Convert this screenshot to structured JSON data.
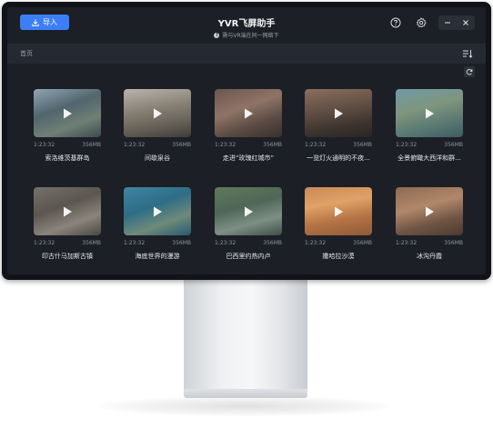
{
  "app": {
    "title": "YVR飞屏助手",
    "subtitle": "需与VR端在同一网络下",
    "import_label": "导入"
  },
  "nav": {
    "breadcrumb": "首页"
  },
  "icons": {
    "import": "download-icon",
    "help": "question-icon",
    "settings": "gear-icon",
    "minimize": "minimize-icon",
    "close": "close-icon",
    "sort": "sort-icon",
    "refresh": "refresh-icon",
    "play": "play-icon"
  },
  "colors": {
    "accent": "#3c7ef5",
    "background": "#1c1f26",
    "navbar": "#252932"
  },
  "videos": [
    {
      "title": "索洛维茨基群岛",
      "duration": "1:23:32",
      "size": "356MB"
    },
    {
      "title": "间歇泉谷",
      "duration": "1:23:32",
      "size": "356MB"
    },
    {
      "title": "走进“玫瑰红城市”",
      "duration": "1:23:32",
      "size": "356MB"
    },
    {
      "title": "一览灯火通明的不夜...",
      "duration": "1:23:32",
      "size": "356MB"
    },
    {
      "title": "全景俯瞰大西洋和群...",
      "duration": "1:23:32",
      "size": "356MB"
    },
    {
      "title": "印古什马加斯古镇",
      "duration": "1:23:32",
      "size": "356MB"
    },
    {
      "title": "海底世界的漫游",
      "duration": "1:23:32",
      "size": "356MB"
    },
    {
      "title": "巴西里约热内卢",
      "duration": "1:23:32",
      "size": "356MB"
    },
    {
      "title": "撒哈拉沙漠",
      "duration": "1:23:32",
      "size": "356MB"
    },
    {
      "title": "冰沟丹霞",
      "duration": "1:23:32",
      "size": "356MB"
    }
  ]
}
